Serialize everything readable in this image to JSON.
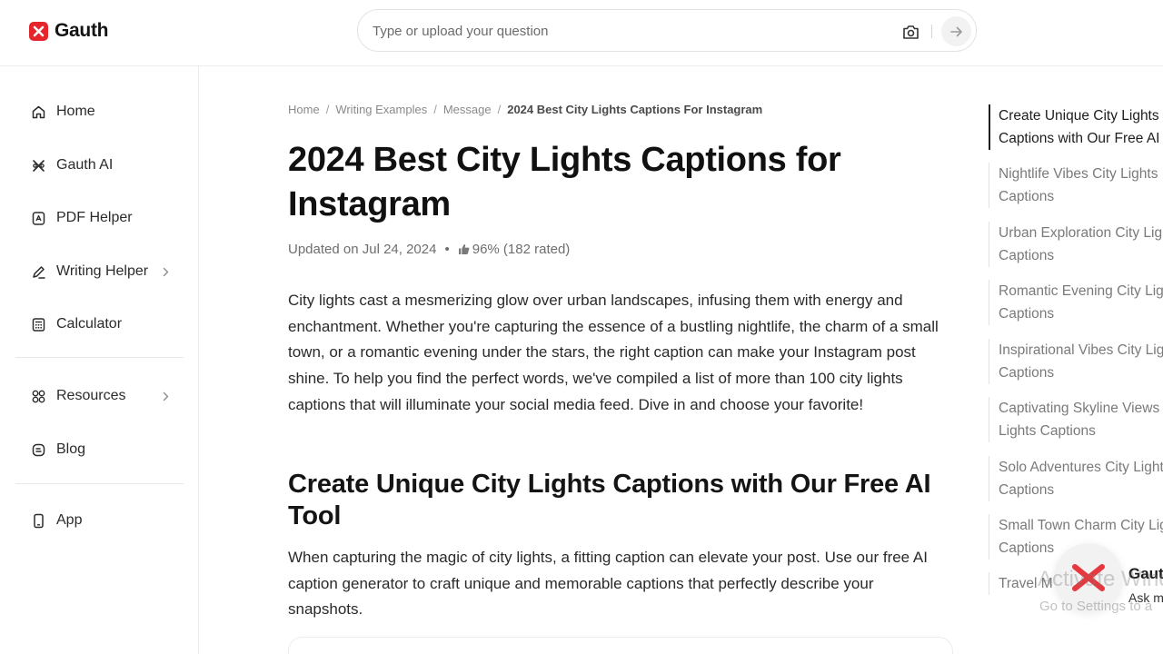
{
  "header": {
    "logo_text": "Gauth",
    "search_placeholder": "Type or upload your question"
  },
  "sidebar": {
    "items": [
      {
        "label": "Home",
        "icon": "home-icon"
      },
      {
        "label": "Gauth AI",
        "icon": "gauth-ai-icon"
      },
      {
        "label": "PDF Helper",
        "icon": "pdf-icon"
      },
      {
        "label": "Writing Helper",
        "icon": "pen-icon",
        "has_submenu": true
      },
      {
        "label": "Calculator",
        "icon": "calculator-icon"
      },
      {
        "label": "Resources",
        "icon": "grid-icon",
        "has_submenu": true
      },
      {
        "label": "Blog",
        "icon": "blog-icon"
      },
      {
        "label": "App",
        "icon": "phone-icon"
      }
    ]
  },
  "breadcrumb": [
    "Home",
    "Writing Examples",
    "Message",
    "2024 Best City Lights Captions For Instagram"
  ],
  "article": {
    "title": "2024 Best City Lights Captions for Instagram",
    "updated": "Updated on Jul 24, 2024",
    "rating": "96% (182 rated)",
    "intro": "City lights cast a mesmerizing glow over urban landscapes, infusing them with energy and enchantment. Whether you're capturing the essence of a bustling nightlife, the charm of a small town, or a romantic evening under the stars, the right caption can make your Instagram post shine. To help you find the perfect words, we've compiled a list of more than 100 city lights captions that will illuminate your social media feed. Dive in and choose your favorite!",
    "section_heading": "Create Unique City Lights Captions with Our Free AI Tool",
    "section_text": "When capturing the magic of city lights, a fitting caption can elevate your post. Use our free AI caption generator to craft unique and memorable captions that perfectly describe your snapshots."
  },
  "toc": [
    {
      "line1": "Create Unique City Lights",
      "line2": "Captions with Our Free AI T",
      "active": true
    },
    {
      "line1": "Nightlife Vibes City Lights",
      "line2": "Captions",
      "active": false
    },
    {
      "line1": "Urban Exploration City Lig",
      "line2": "Captions",
      "active": false
    },
    {
      "line1": "Romantic Evening City Lig",
      "line2": "Captions",
      "active": false
    },
    {
      "line1": "Inspirational Vibes City Lig",
      "line2": "Captions",
      "active": false
    },
    {
      "line1": "Captivating Skyline Views",
      "line2": "Lights Captions",
      "active": false
    },
    {
      "line1": "Solo Adventures City Light",
      "line2": "Captions",
      "active": false
    },
    {
      "line1": "Small Town Charm City Lig",
      "line2": "Captions",
      "active": false
    },
    {
      "line1": "Travel M",
      "line2": "",
      "active": false
    }
  ],
  "widget": {
    "label": "Gaut",
    "sub": "Ask m"
  },
  "watermark": {
    "line1": "Activate Windo",
    "line2": "Go to Settings to a"
  },
  "colors": {
    "brand": "#e5242b",
    "text": "#1f1f1f",
    "muted": "#7a7a7a"
  }
}
